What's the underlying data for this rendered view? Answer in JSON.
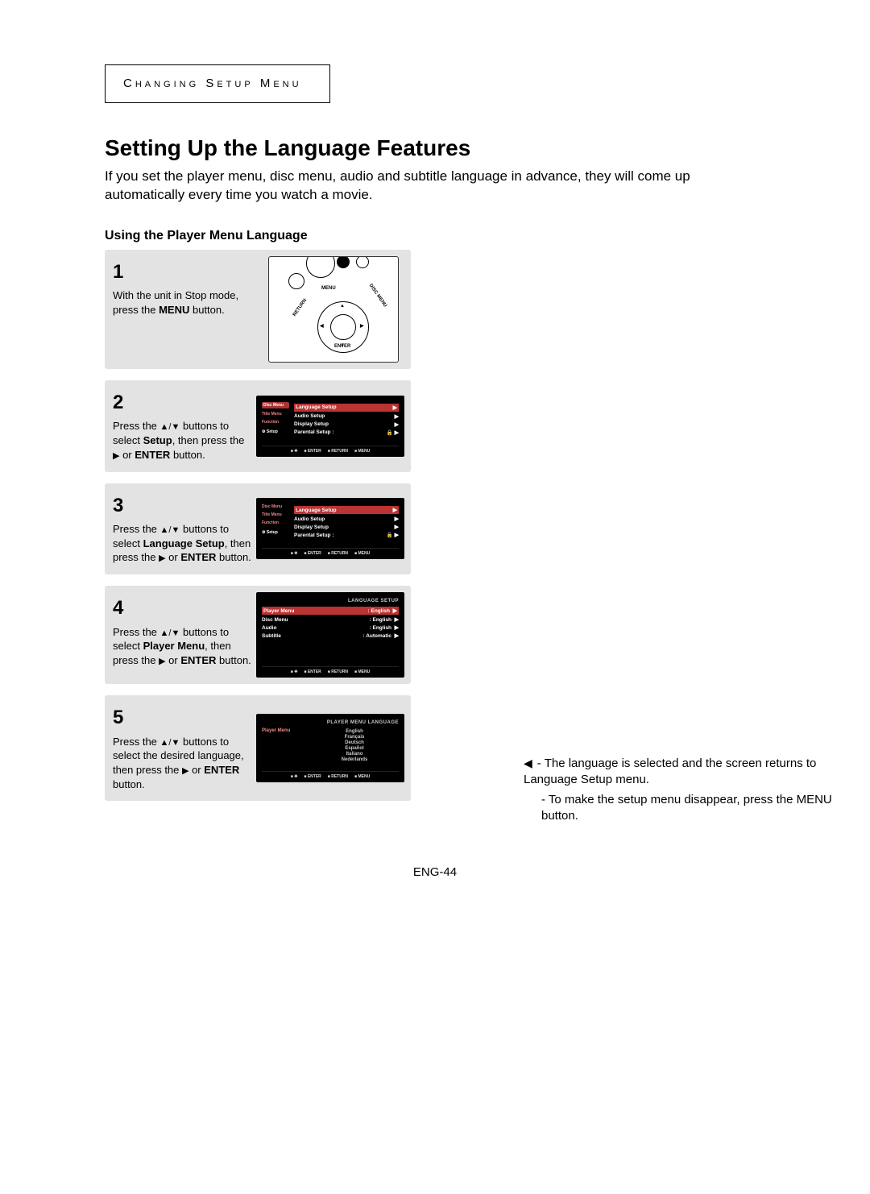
{
  "section_label": "Changing Setup Menu",
  "title": "Setting Up the Language Features",
  "intro": "If you set the player menu, disc menu, audio and subtitle language in advance, they will come up automatically every time you watch a movie.",
  "subhead": "Using the Player Menu Language",
  "steps": {
    "s1": {
      "num": "1",
      "line1": "With the unit in Stop mode, press the ",
      "bold1": "MENU",
      "line2": " button."
    },
    "s2": {
      "num": "2",
      "pre": "Press the ",
      "arrows": "▲/▼",
      "mid": " buttons to select ",
      "bold": "Setup",
      "post": ", then press the ",
      "arrow2": "▶",
      "post2": " or ",
      "bold2": "ENTER",
      "post3": " button."
    },
    "s3": {
      "num": "3",
      "pre": "Press the ",
      "arrows": "▲/▼",
      "mid": " buttons to select ",
      "bold": "Language Setup",
      "post": ", then press the ",
      "arrow2": "▶",
      "post2": " or ",
      "bold2": "ENTER",
      "post3": " button."
    },
    "s4": {
      "num": "4",
      "pre": "Press the ",
      "arrows": "▲/▼",
      "mid": " buttons to select ",
      "bold": "Player Menu",
      "post": ", then press the ",
      "arrow2": "▶",
      "post2": " or ",
      "bold2": "ENTER",
      "post3": " button."
    },
    "s5": {
      "num": "5",
      "pre": "Press the ",
      "arrows": "▲/▼",
      "mid": " buttons to select the desired language, then press the ",
      "arrow2": "▶",
      "post2": " or ",
      "bold2": "ENTER",
      "post3": " button."
    }
  },
  "osd_setup": {
    "side_items": [
      "Disc Menu",
      "Title Menu",
      "Function",
      "Setup"
    ],
    "menu_items": [
      {
        "label": "Language Setup",
        "indicator": "▶"
      },
      {
        "label": "Audio Setup",
        "indicator": "▶"
      },
      {
        "label": "Display Setup",
        "indicator": "▶"
      },
      {
        "label": "Parental Setup  :",
        "indicator": "▶"
      }
    ],
    "footer": [
      "ENTER",
      "RETURN",
      "MENU"
    ]
  },
  "osd_lang_setup": {
    "head": "LANGUAGE SETUP",
    "rows": [
      {
        "label": "Player Menu",
        "value": ": English",
        "indicator": "▶"
      },
      {
        "label": "Disc Menu",
        "value": ": English",
        "indicator": "▶"
      },
      {
        "label": "Audio",
        "value": ": English",
        "indicator": "▶"
      },
      {
        "label": "Subtitle",
        "value": ": Automatic",
        "indicator": "▶"
      }
    ],
    "footer": [
      "ENTER",
      "RETURN",
      "MENU"
    ]
  },
  "osd_player_lang": {
    "head": "PLAYER MENU LANGUAGE",
    "left_label": "Player Menu",
    "options": [
      "English",
      "Français",
      "Deutsch",
      "Español",
      "Italiano",
      "Nederlands"
    ],
    "footer": [
      "ENTER",
      "RETURN",
      "MENU"
    ]
  },
  "remote_labels": {
    "menu": "MENU",
    "enter": "ENTER",
    "return": "RETURN",
    "disc": "DISC MENU"
  },
  "notes": {
    "n1": "The language is selected and the screen returns to Language Setup menu.",
    "n2": "To make the setup menu disappear, press the MENU button."
  },
  "page_number": "ENG-44"
}
